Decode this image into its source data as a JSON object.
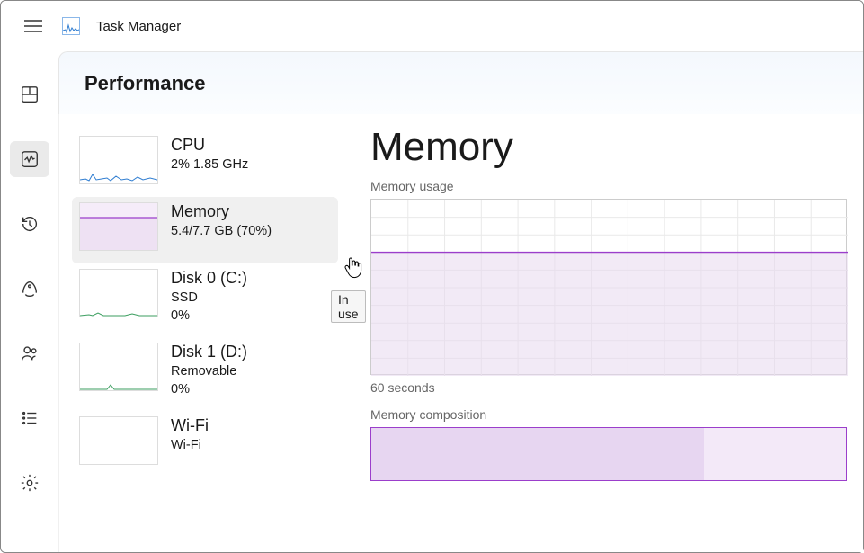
{
  "app": {
    "title": "Task Manager"
  },
  "page": {
    "title": "Performance"
  },
  "nav": {
    "processes": "Processes",
    "performance": "Performance",
    "history": "App history",
    "startup": "Startup apps",
    "users": "Users",
    "details": "Details",
    "services": "Services"
  },
  "items": {
    "cpu": {
      "title": "CPU",
      "sub": "2%  1.85 GHz"
    },
    "mem": {
      "title": "Memory",
      "sub": "5.4/7.7 GB (70%)"
    },
    "disk0": {
      "title": "Disk 0 (C:)",
      "sub1": "SSD",
      "sub2": "0%"
    },
    "disk1": {
      "title": "Disk 1 (D:)",
      "sub1": "Removable",
      "sub2": "0%"
    },
    "wifi": {
      "title": "Wi-Fi",
      "sub1": "Wi-Fi"
    }
  },
  "tooltip": "In use",
  "detail": {
    "title": "Memory",
    "usage_label": "Memory usage",
    "time_label": "60 seconds",
    "comp_label": "Memory composition"
  },
  "chart_data": {
    "type": "area",
    "title": "Memory usage",
    "xlabel": "60 seconds",
    "ylabel": "",
    "ylim": [
      0,
      7.7
    ],
    "x_seconds": [
      60,
      55,
      50,
      45,
      40,
      35,
      30,
      25,
      20,
      15,
      10,
      5,
      0
    ],
    "values_gb": [
      5.4,
      5.4,
      5.4,
      5.4,
      5.4,
      5.4,
      5.4,
      5.4,
      5.4,
      5.4,
      5.4,
      5.4,
      5.4
    ],
    "grid": {
      "rows": 10,
      "cols": 13
    },
    "series_color": "#9b3ecb"
  },
  "composition_data": {
    "type": "bar",
    "total_gb": 7.7,
    "segments": [
      {
        "name": "In use",
        "value_gb": 5.4
      }
    ]
  },
  "colors": {
    "accent": "#9b3ecb",
    "cpu": "#2f7dd1"
  }
}
